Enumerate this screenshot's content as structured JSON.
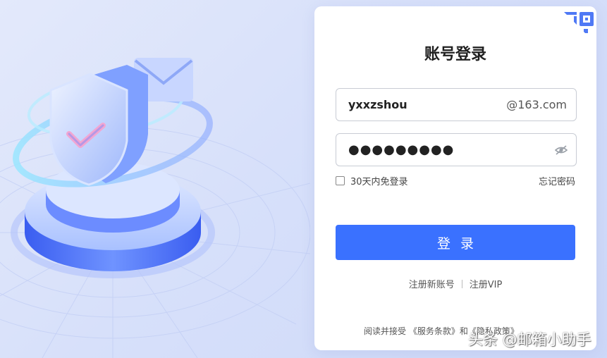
{
  "login": {
    "title": "账号登录",
    "username": {
      "value": "yxxzshou",
      "suffix": "@163.com"
    },
    "password": {
      "masked_value": "●●●●●●●●●"
    },
    "remember_label": "30天内免登录",
    "forgot_label": "忘记密码",
    "login_button": "登录",
    "register_link": "注册新账号",
    "vip_link": "注册VIP",
    "agreement_text": "阅读并接受 《服务条款》和《隐私政策》"
  },
  "watermark": "头条 @邮箱小助手",
  "colors": {
    "accent": "#3a71ff",
    "background": "#d7e0fa"
  },
  "icons": {
    "qr_corner": "qr-code-icon",
    "password_toggle": "eye-hidden-icon",
    "illustration": "security-shield-illustration"
  }
}
